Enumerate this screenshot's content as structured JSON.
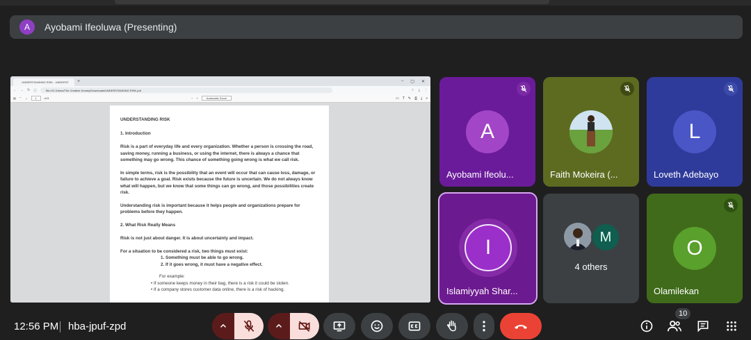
{
  "presenter": {
    "initial": "A",
    "label": "Ayobami Ifeoluwa (Presenting)"
  },
  "shared_screen": {
    "browser": {
      "tab_title": "UNDERSTANDING RISK - UNDERST",
      "url": "file:///C:/Users/The Creative Domey/Downloads/UNDERSTANDING RISK.pdf"
    },
    "pdf_toolbar": {
      "page_value": "1",
      "page_total": "of 5",
      "zoom": "Automatic Zoom"
    },
    "document": {
      "title": "UNDERSTANDING RISK",
      "section1": "1. Introduction",
      "p1": "Risk is a part of everyday life and every organization. Whether a person is crossing the road, saving money, running a business, or using the internet, there is always a chance that something may go wrong. This chance of something going wrong is what we call risk.",
      "p2": "In simple terms, risk is the possibility that an event will occur that can cause loss, damage, or failure to achieve a goal. Risk exists because the future is uncertain. We do not always know what will happen, but we know that some things can go wrong, and those possibilities create risk.",
      "p3": "Understanding risk is important because it helps people and organizations prepare for problems before they happen.",
      "section2": "2. What Risk Really Means",
      "p4": "Risk is not just about danger. It is about uncertainty and impact.",
      "p5": "For a situation to be considered a risk, two things must exist:",
      "li1": "1.      Something must be able to go wrong.",
      "li2": "2.      If it goes wrong, it must have a negative effect.",
      "example_label": "For example:",
      "bullet1": "•      If someone keeps money in their bag, there is a risk it could be stolen.",
      "bullet2": "•      If a company stores customer data online, there is a risk of hacking."
    }
  },
  "tiles": {
    "ayobami": {
      "initial": "A",
      "name": "Ayobami Ifeolu..."
    },
    "faith": {
      "name": "Faith Mokeira (..."
    },
    "loveth": {
      "initial": "L",
      "name": "Loveth Adebayo"
    },
    "islamiyyah": {
      "initial": "I",
      "name": "Islamiyyah Shar..."
    },
    "others": {
      "initial": "M",
      "label": "4 others"
    },
    "olamilekan": {
      "initial": "O",
      "name": "Olamilekan"
    }
  },
  "bottom_bar": {
    "time": "12:56 PM",
    "meeting_code": "hba-jpuf-zpd",
    "people_count": "10"
  },
  "colors": {
    "accent_red": "#ea4335",
    "muted_control_bg": "#f9dedc",
    "presenter_purple": "#8e3fc4"
  }
}
